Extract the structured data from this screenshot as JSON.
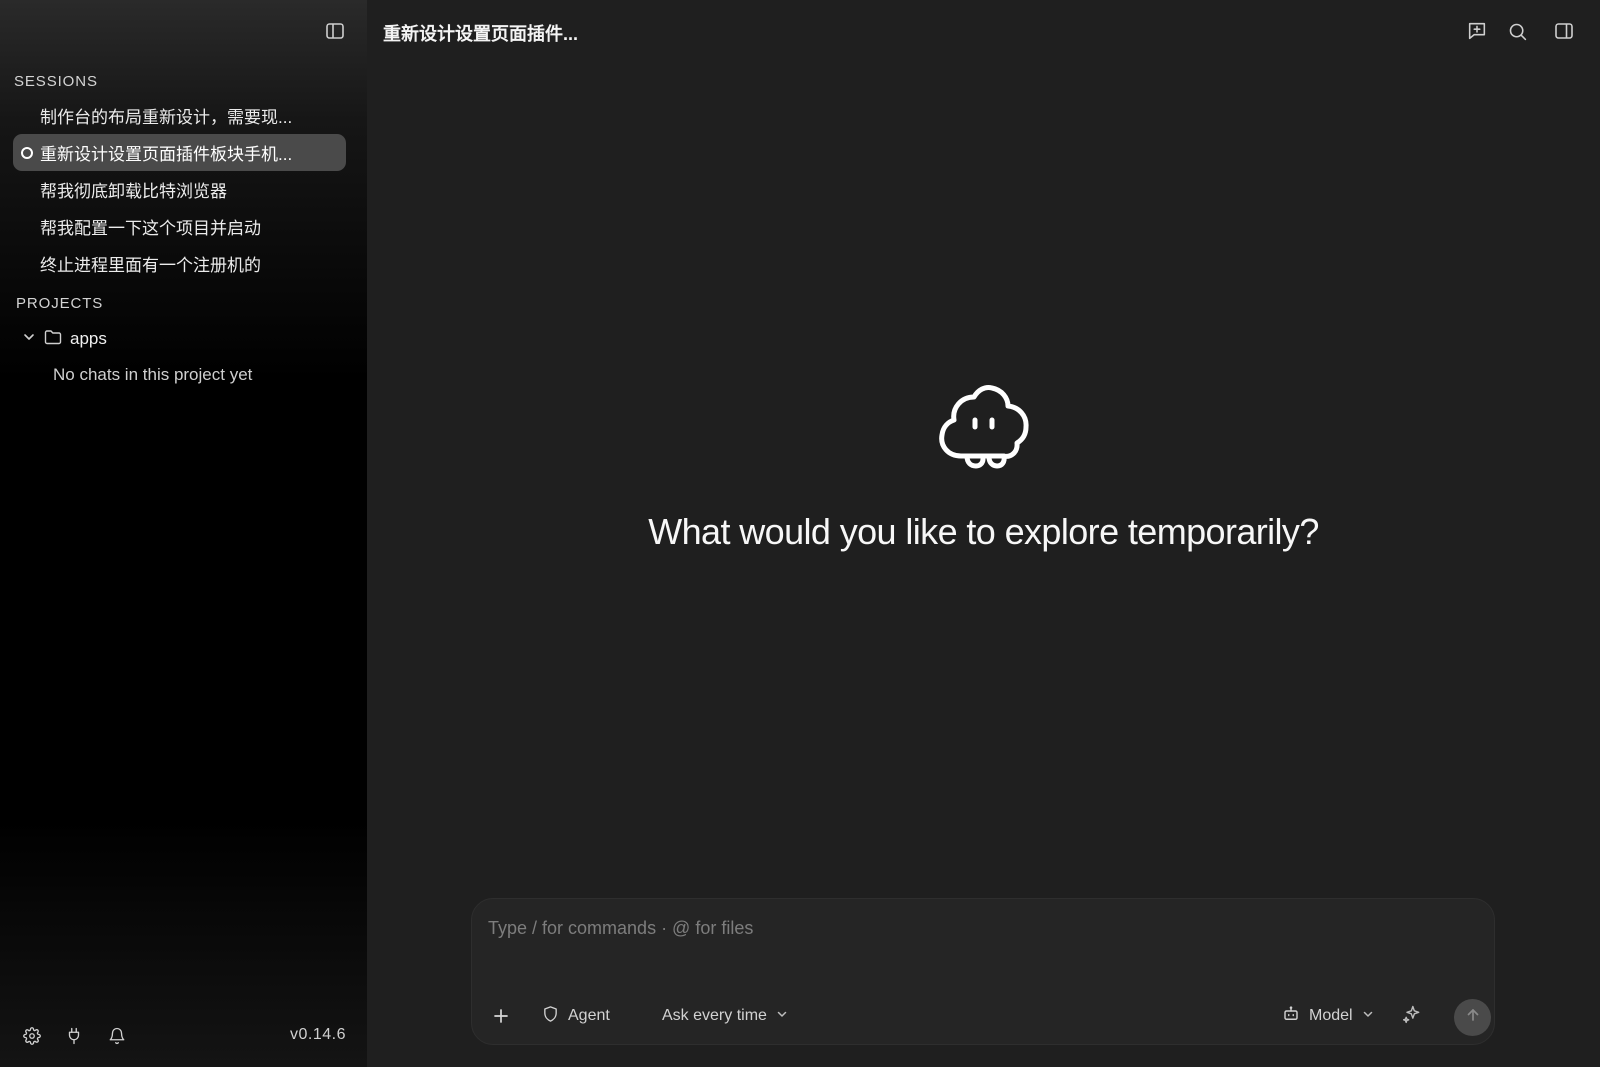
{
  "sidebar": {
    "sessions_label": "SESSIONS",
    "sessions": [
      {
        "title": "制作台的布局重新设计，需要现...",
        "active": false
      },
      {
        "title": "重新设计设置页面插件板块手机...",
        "active": true
      },
      {
        "title": "帮我彻底卸载比特浏览器",
        "active": false
      },
      {
        "title": "帮我配置一下这个项目并启动",
        "active": false
      },
      {
        "title": "终止进程里面有一个注册机的",
        "active": false
      }
    ],
    "projects_label": "PROJECTS",
    "projects": [
      {
        "name": "apps",
        "empty_text": "No chats in this project yet"
      }
    ],
    "footer_icons": [
      "gear-icon",
      "plug-icon",
      "bell-icon"
    ],
    "version": "v0.14.6"
  },
  "main": {
    "title": "重新设计设置页面插件...",
    "top_icons": [
      "new-chat-icon",
      "search-icon",
      "right-panel-icon"
    ],
    "hero_title": "What would you like to explore temporarily?",
    "composer": {
      "placeholder": "Type / for commands · @ for files",
      "agent_label": "Agent",
      "permission_label": "Ask every time",
      "model_label": "Model"
    }
  },
  "colors": {
    "background": "#1f1f1f",
    "sidebar_active": "#4a4a4a",
    "composer_bg": "#252525",
    "send_button": "#4a4a4a"
  }
}
